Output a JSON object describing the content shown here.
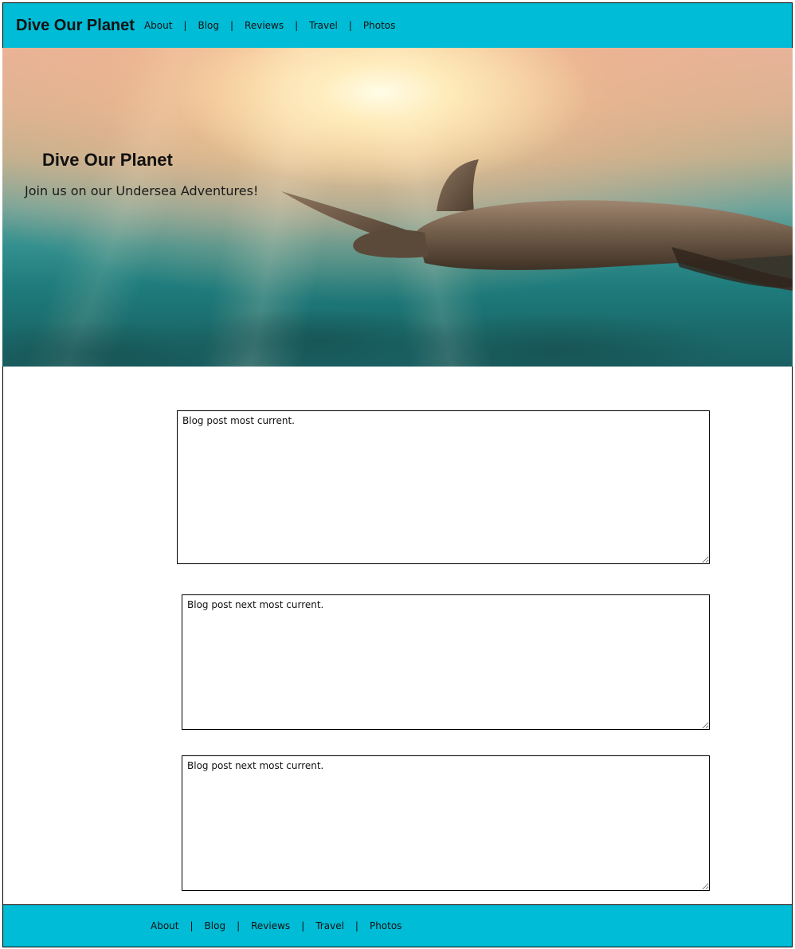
{
  "header": {
    "brand": "Dive Our Planet",
    "nav": [
      {
        "label": "About"
      },
      {
        "label": "Blog"
      },
      {
        "label": "Reviews"
      },
      {
        "label": "Travel"
      },
      {
        "label": "Photos"
      }
    ],
    "separator": "|"
  },
  "hero": {
    "title": "Dive Our Planet",
    "subtitle": "Join us on our Undersea Adventures!"
  },
  "posts": [
    {
      "text": "Blog post most current."
    },
    {
      "text": "Blog post next most current."
    },
    {
      "text": "Blog post next most current."
    }
  ],
  "footer": {
    "nav": [
      {
        "label": "About"
      },
      {
        "label": "Blog"
      },
      {
        "label": "Reviews"
      },
      {
        "label": "Travel"
      },
      {
        "label": "Photos"
      }
    ],
    "separator": "|"
  },
  "colors": {
    "accent": "#00bcd6",
    "text": "#111111",
    "background": "#ffffff"
  }
}
